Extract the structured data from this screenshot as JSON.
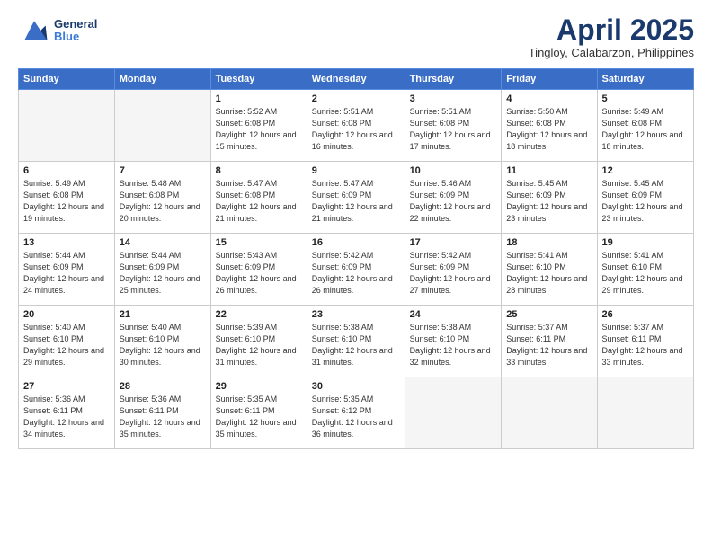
{
  "header": {
    "logo_line1": "General",
    "logo_line2": "Blue",
    "month": "April 2025",
    "location": "Tingloy, Calabarzon, Philippines"
  },
  "days_of_week": [
    "Sunday",
    "Monday",
    "Tuesday",
    "Wednesday",
    "Thursday",
    "Friday",
    "Saturday"
  ],
  "weeks": [
    [
      {
        "day": "",
        "info": ""
      },
      {
        "day": "",
        "info": ""
      },
      {
        "day": "1",
        "info": "Sunrise: 5:52 AM\nSunset: 6:08 PM\nDaylight: 12 hours and 15 minutes."
      },
      {
        "day": "2",
        "info": "Sunrise: 5:51 AM\nSunset: 6:08 PM\nDaylight: 12 hours and 16 minutes."
      },
      {
        "day": "3",
        "info": "Sunrise: 5:51 AM\nSunset: 6:08 PM\nDaylight: 12 hours and 17 minutes."
      },
      {
        "day": "4",
        "info": "Sunrise: 5:50 AM\nSunset: 6:08 PM\nDaylight: 12 hours and 18 minutes."
      },
      {
        "day": "5",
        "info": "Sunrise: 5:49 AM\nSunset: 6:08 PM\nDaylight: 12 hours and 18 minutes."
      }
    ],
    [
      {
        "day": "6",
        "info": "Sunrise: 5:49 AM\nSunset: 6:08 PM\nDaylight: 12 hours and 19 minutes."
      },
      {
        "day": "7",
        "info": "Sunrise: 5:48 AM\nSunset: 6:08 PM\nDaylight: 12 hours and 20 minutes."
      },
      {
        "day": "8",
        "info": "Sunrise: 5:47 AM\nSunset: 6:08 PM\nDaylight: 12 hours and 21 minutes."
      },
      {
        "day": "9",
        "info": "Sunrise: 5:47 AM\nSunset: 6:09 PM\nDaylight: 12 hours and 21 minutes."
      },
      {
        "day": "10",
        "info": "Sunrise: 5:46 AM\nSunset: 6:09 PM\nDaylight: 12 hours and 22 minutes."
      },
      {
        "day": "11",
        "info": "Sunrise: 5:45 AM\nSunset: 6:09 PM\nDaylight: 12 hours and 23 minutes."
      },
      {
        "day": "12",
        "info": "Sunrise: 5:45 AM\nSunset: 6:09 PM\nDaylight: 12 hours and 23 minutes."
      }
    ],
    [
      {
        "day": "13",
        "info": "Sunrise: 5:44 AM\nSunset: 6:09 PM\nDaylight: 12 hours and 24 minutes."
      },
      {
        "day": "14",
        "info": "Sunrise: 5:44 AM\nSunset: 6:09 PM\nDaylight: 12 hours and 25 minutes."
      },
      {
        "day": "15",
        "info": "Sunrise: 5:43 AM\nSunset: 6:09 PM\nDaylight: 12 hours and 26 minutes."
      },
      {
        "day": "16",
        "info": "Sunrise: 5:42 AM\nSunset: 6:09 PM\nDaylight: 12 hours and 26 minutes."
      },
      {
        "day": "17",
        "info": "Sunrise: 5:42 AM\nSunset: 6:09 PM\nDaylight: 12 hours and 27 minutes."
      },
      {
        "day": "18",
        "info": "Sunrise: 5:41 AM\nSunset: 6:10 PM\nDaylight: 12 hours and 28 minutes."
      },
      {
        "day": "19",
        "info": "Sunrise: 5:41 AM\nSunset: 6:10 PM\nDaylight: 12 hours and 29 minutes."
      }
    ],
    [
      {
        "day": "20",
        "info": "Sunrise: 5:40 AM\nSunset: 6:10 PM\nDaylight: 12 hours and 29 minutes."
      },
      {
        "day": "21",
        "info": "Sunrise: 5:40 AM\nSunset: 6:10 PM\nDaylight: 12 hours and 30 minutes."
      },
      {
        "day": "22",
        "info": "Sunrise: 5:39 AM\nSunset: 6:10 PM\nDaylight: 12 hours and 31 minutes."
      },
      {
        "day": "23",
        "info": "Sunrise: 5:38 AM\nSunset: 6:10 PM\nDaylight: 12 hours and 31 minutes."
      },
      {
        "day": "24",
        "info": "Sunrise: 5:38 AM\nSunset: 6:10 PM\nDaylight: 12 hours and 32 minutes."
      },
      {
        "day": "25",
        "info": "Sunrise: 5:37 AM\nSunset: 6:11 PM\nDaylight: 12 hours and 33 minutes."
      },
      {
        "day": "26",
        "info": "Sunrise: 5:37 AM\nSunset: 6:11 PM\nDaylight: 12 hours and 33 minutes."
      }
    ],
    [
      {
        "day": "27",
        "info": "Sunrise: 5:36 AM\nSunset: 6:11 PM\nDaylight: 12 hours and 34 minutes."
      },
      {
        "day": "28",
        "info": "Sunrise: 5:36 AM\nSunset: 6:11 PM\nDaylight: 12 hours and 35 minutes."
      },
      {
        "day": "29",
        "info": "Sunrise: 5:35 AM\nSunset: 6:11 PM\nDaylight: 12 hours and 35 minutes."
      },
      {
        "day": "30",
        "info": "Sunrise: 5:35 AM\nSunset: 6:12 PM\nDaylight: 12 hours and 36 minutes."
      },
      {
        "day": "",
        "info": ""
      },
      {
        "day": "",
        "info": ""
      },
      {
        "day": "",
        "info": ""
      }
    ]
  ]
}
